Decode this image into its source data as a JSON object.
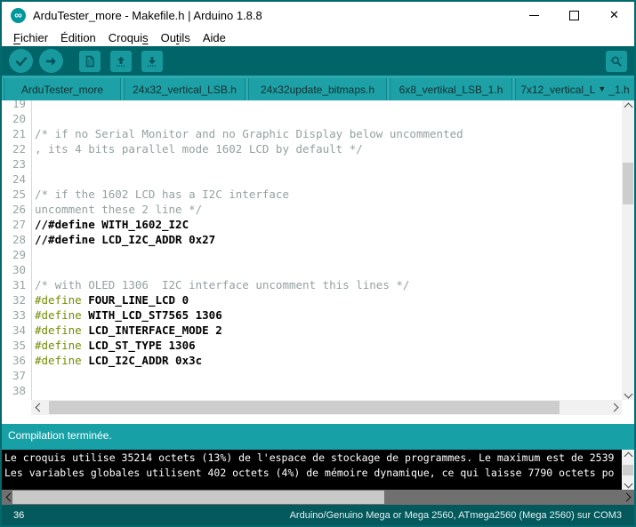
{
  "window": {
    "title": "ArduTester_more - Makefile.h | Arduino 1.8.8"
  },
  "icons": {
    "logo_glyph": "∞",
    "close_glyph": "✕",
    "minimize": "minimize-line",
    "maximize": "maximize-box",
    "verify": "checkmark-circle",
    "upload": "arrow-right-circle",
    "new_sketch": "document",
    "open": "arrow-up-tray",
    "save": "arrow-down-tray",
    "serial_monitor": "magnifier",
    "tab_dropdown_glyph": "▼"
  },
  "menu": {
    "items": [
      {
        "pre": "",
        "mn": "F",
        "post": "ichier"
      },
      {
        "pre": "Édition",
        "mn": "",
        "post": ""
      },
      {
        "pre": "Croqui",
        "mn": "s",
        "post": ""
      },
      {
        "pre": "Ou",
        "mn": "t",
        "post": "ils"
      },
      {
        "pre": "Aide",
        "mn": "",
        "post": ""
      }
    ]
  },
  "tabs": {
    "items": [
      "ArduTester_more",
      "24x32_vertical_LSB.h",
      "24x32update_bitmaps.h",
      "6x8_vertikal_LSB_1.h"
    ],
    "last": {
      "left": "7x12_vertical_L",
      "right": "_1.h"
    }
  },
  "editor": {
    "lines": [
      {
        "n": 19,
        "t": "",
        "s": "plain"
      },
      {
        "n": 20,
        "t": "",
        "s": "plain"
      },
      {
        "n": 21,
        "t": "/* if no Serial Monitor and no Graphic Display below uncommented",
        "s": "comment"
      },
      {
        "n": 22,
        "t": ", its 4 bits parallel mode 1602 LCD by default */",
        "s": "comment"
      },
      {
        "n": 23,
        "t": "",
        "s": "plain"
      },
      {
        "n": 24,
        "t": "",
        "s": "plain"
      },
      {
        "n": 25,
        "t": "/* if the 1602 LCD has a I2C interface",
        "s": "comment"
      },
      {
        "n": 26,
        "t": "uncomment these 2 line */",
        "s": "comment"
      },
      {
        "n": 27,
        "t": "//#define WITH_1602_I2C",
        "s": "bold"
      },
      {
        "n": 28,
        "t": "//#define LCD_I2C_ADDR 0x27",
        "s": "bold"
      },
      {
        "n": 29,
        "t": "",
        "s": "plain"
      },
      {
        "n": 30,
        "t": "",
        "s": "plain"
      },
      {
        "n": 31,
        "t": "/* with OLED 1306  I2C interface uncomment this lines */",
        "s": "comment"
      },
      {
        "n": 32,
        "kw": "#define",
        "t": " FOUR_LINE_LCD 0",
        "s": "define"
      },
      {
        "n": 33,
        "kw": "#define",
        "t": " WITH_LCD_ST7565 1306",
        "s": "define"
      },
      {
        "n": 34,
        "kw": "#define",
        "t": " LCD_INTERFACE_MODE 2",
        "s": "define"
      },
      {
        "n": 35,
        "kw": "#define",
        "t": " LCD_ST_TYPE 1306",
        "s": "define"
      },
      {
        "n": 36,
        "kw": "#define",
        "t": " LCD_I2C_ADDR 0x3c",
        "s": "define"
      },
      {
        "n": 37,
        "t": "",
        "s": "plain"
      },
      {
        "n": 38,
        "t": "",
        "s": "plain"
      }
    ]
  },
  "status": {
    "message": "Compilation terminée."
  },
  "console": {
    "lines": [
      "Le croquis utilise 35214 octets (13%) de l'espace de stockage de programmes. Le maximum est de 2539",
      "Les variables globales utilisent 402 octets (4%) de mémoire dynamique, ce qui laisse 7790 octets po"
    ]
  },
  "footer": {
    "line": "36",
    "board": "Arduino/Genuino Mega or Mega 2560, ATmega2560 (Mega 2560) sur COM3"
  },
  "colors": {
    "toolbar": "#006468",
    "button": "#17999e",
    "tabbar": "#29abb0",
    "tab": "#1da1a6",
    "accent": "#17a1a6",
    "footer": "#04595d",
    "keyword": "#728E00",
    "comment": "#95a0a0",
    "console_bg": "#000000"
  }
}
